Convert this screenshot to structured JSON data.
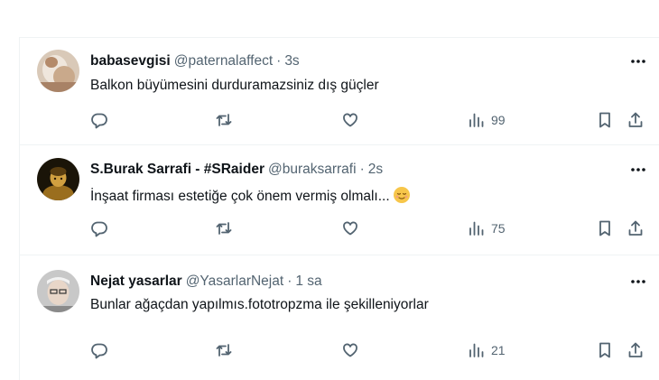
{
  "tweets": [
    {
      "name": "babasevgisi",
      "handle": "@paternalaffect",
      "separator": "·",
      "time": "3s",
      "text": "Balkon büyümesini durduramazsiniz dış güçler",
      "views": "99"
    },
    {
      "name": "S.Burak Sarrafi - #SRaider",
      "handle": "@buraksarrafi",
      "separator": "·",
      "time": "2s",
      "text": "İnşaat firması estetiğe çok önem vermiş olmalı...",
      "views": "75"
    },
    {
      "name": "Nejat yasarlar",
      "handle": "@YasarlarNejat",
      "separator": "·",
      "time": "1 sa",
      "text": "Bunlar ağaçdan yapılmıs.fototropzma ile şekilleniyorlar",
      "views": "21"
    }
  ],
  "icons": {
    "reply": "reply-icon",
    "retweet": "retweet-icon",
    "like": "heart-icon",
    "views": "views-chart-icon",
    "bookmark": "bookmark-icon",
    "share": "share-icon",
    "more": "more-dots-icon",
    "emoji": "relieved-face-emoji"
  },
  "colors": {
    "text": "#0f1419",
    "secondary": "#536471",
    "divider": "#eff3f4"
  }
}
